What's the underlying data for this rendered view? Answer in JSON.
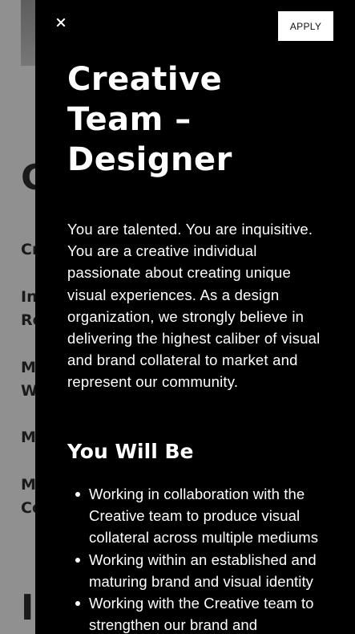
{
  "background": {
    "heading": "C",
    "items": [
      "Cr",
      "In",
      "Re",
      "M",
      "W",
      "M",
      "M",
      "Co"
    ],
    "bottom_heading": "In"
  },
  "panel": {
    "close_icon": "close-icon",
    "apply_label": "APPLY",
    "title": "Creative Team – Designer",
    "intro": "You are talented. You are inquisitive. You are a creative individual passionate about creating unique visual experiences. As a design organization, we strongly believe in delivering the highest caliber of visual and brand collateral to market and represent our community.",
    "section_heading": "You Will Be",
    "bullets": [
      "Working in collaboration with the Creative team to produce visual collateral across multiple mediums",
      "Working within an established and maturing brand and visual identity",
      "Working with the Creative team to strengthen our brand and"
    ]
  },
  "colors": {
    "panel_bg": "#000000",
    "panel_text": "#ffffff",
    "backdrop": "#909090",
    "apply_bg": "#ffffff"
  }
}
